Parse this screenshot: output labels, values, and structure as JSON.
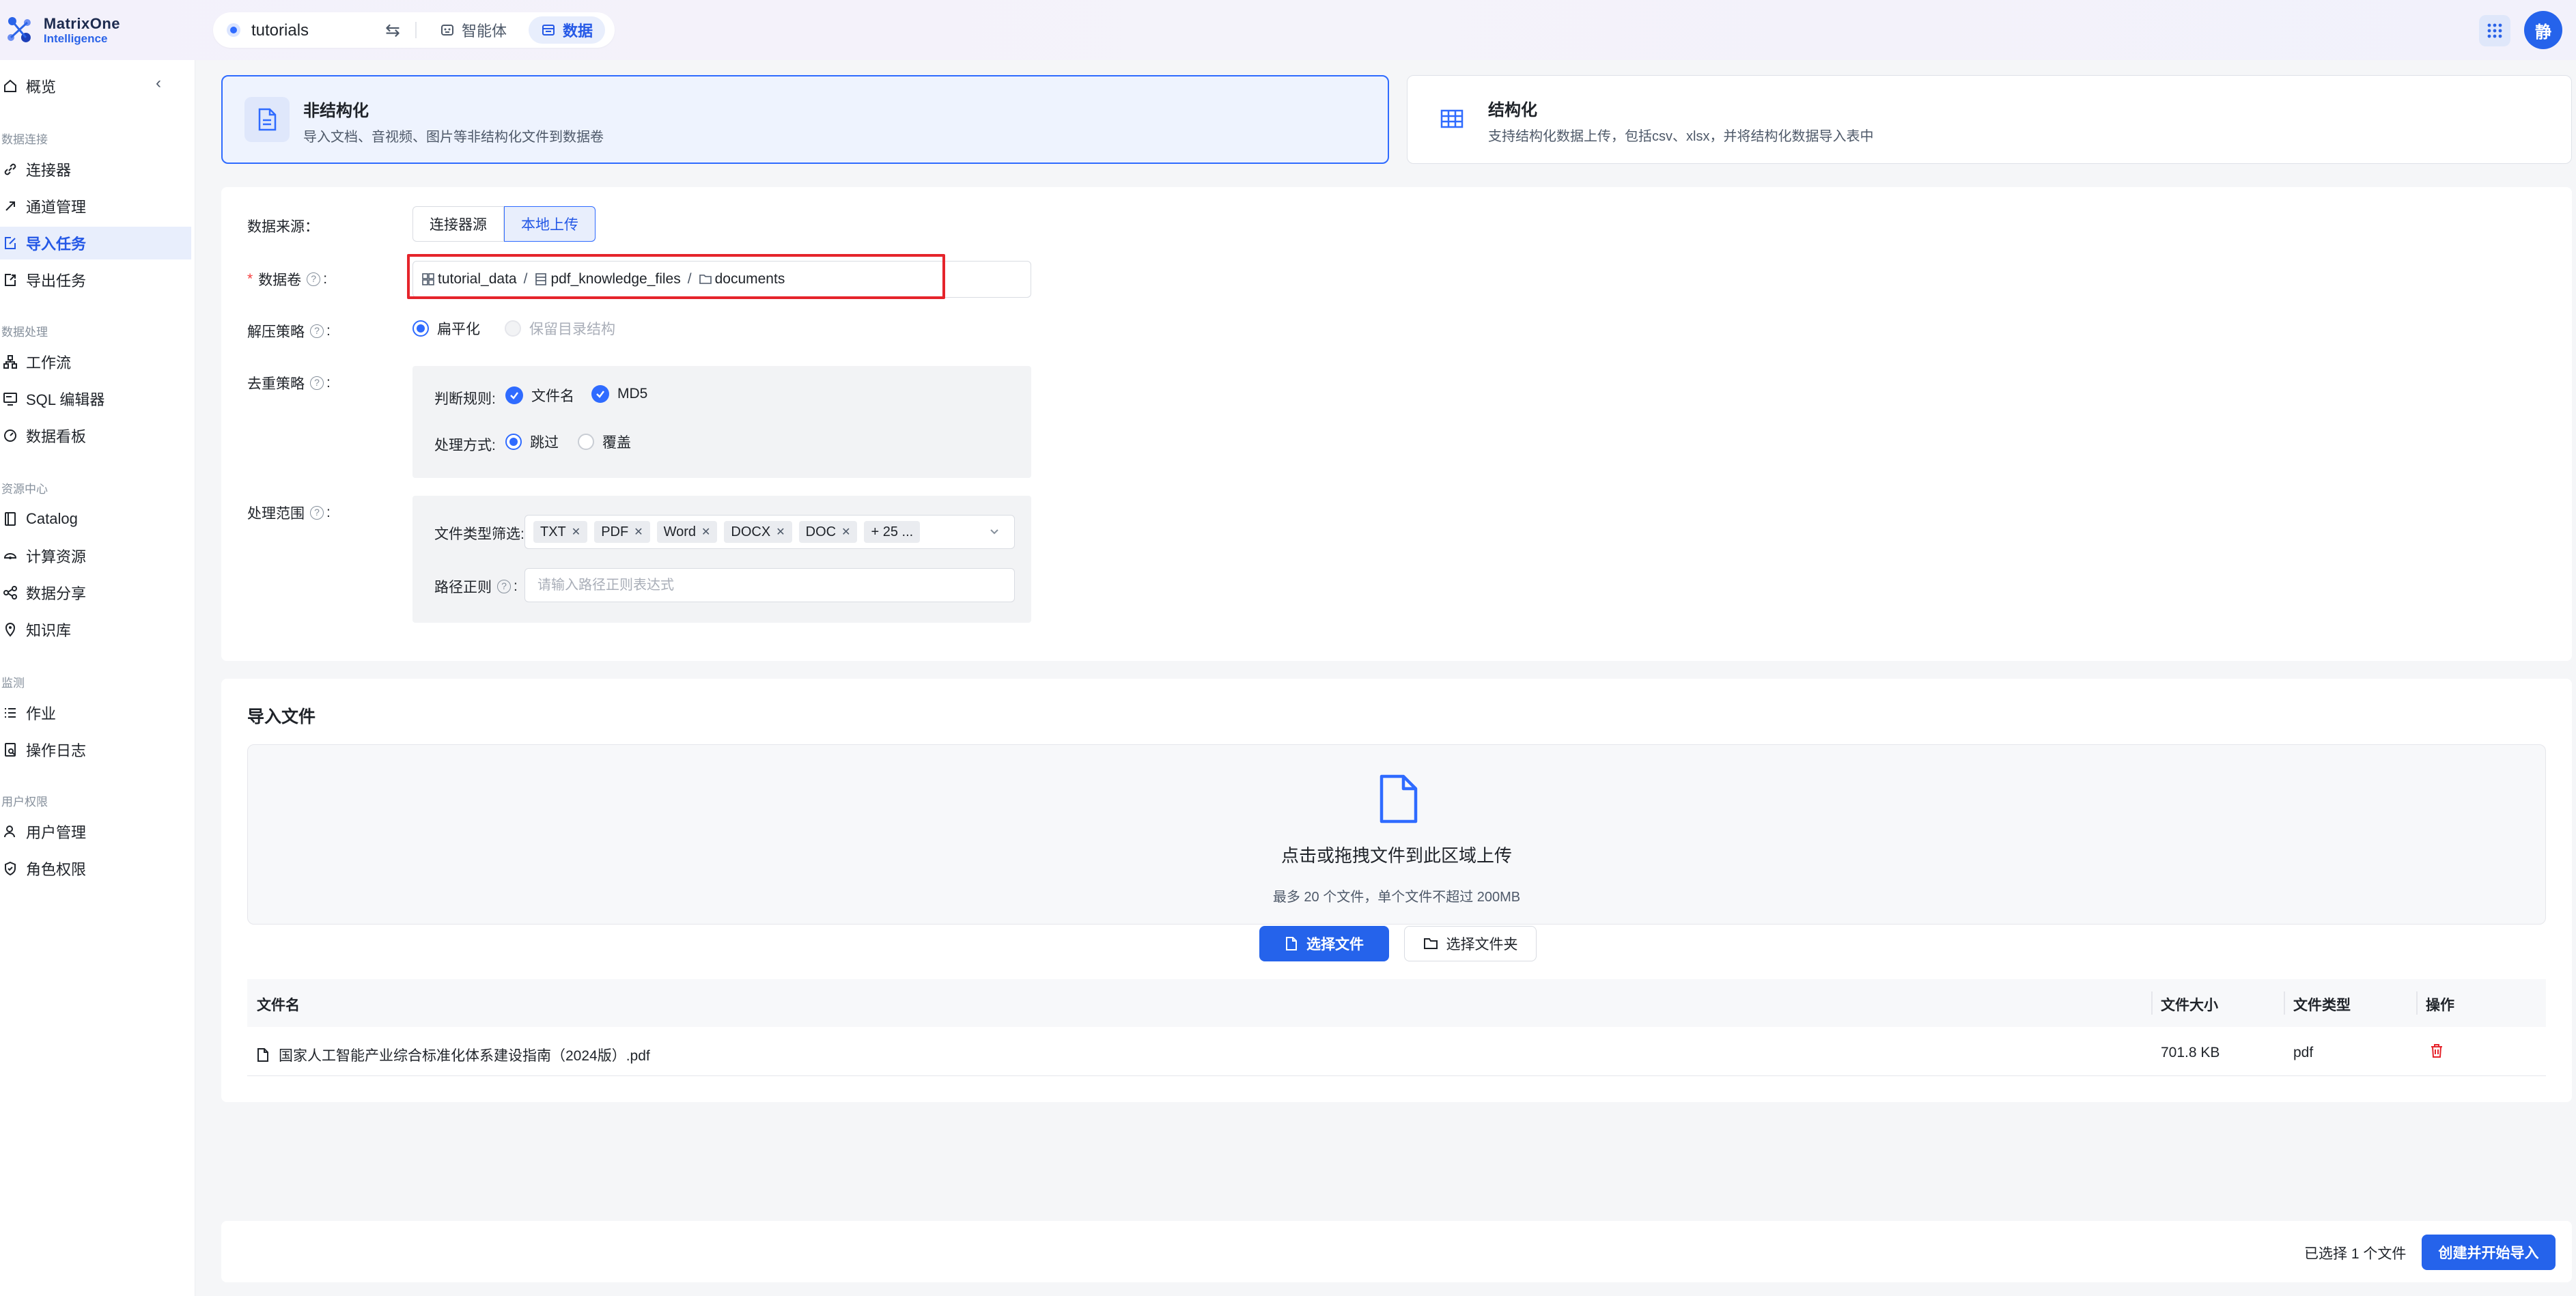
{
  "brand": {
    "line1": "MatrixOne",
    "line2": "Intelligence"
  },
  "topbar": {
    "workspace": "tutorials",
    "tabs": [
      {
        "label": "智能体",
        "icon": "robot-icon",
        "active": false
      },
      {
        "label": "数据",
        "icon": "data-icon",
        "active": true
      }
    ],
    "avatar": "静"
  },
  "sidebar": {
    "overview": "概览",
    "groups": [
      {
        "title": "数据连接",
        "items": [
          {
            "label": "连接器",
            "icon": "link-icon"
          },
          {
            "label": "通道管理",
            "icon": "channel-icon"
          },
          {
            "label": "导入任务",
            "icon": "import-icon",
            "active": true
          },
          {
            "label": "导出任务",
            "icon": "export-icon"
          }
        ]
      },
      {
        "title": "数据处理",
        "items": [
          {
            "label": "工作流",
            "icon": "workflow-icon"
          },
          {
            "label": "SQL 编辑器",
            "icon": "sql-icon"
          },
          {
            "label": "数据看板",
            "icon": "dashboard-icon"
          }
        ]
      },
      {
        "title": "资源中心",
        "items": [
          {
            "label": "Catalog",
            "icon": "catalog-icon"
          },
          {
            "label": "计算资源",
            "icon": "compute-icon"
          },
          {
            "label": "数据分享",
            "icon": "share-icon"
          },
          {
            "label": "知识库",
            "icon": "knowledge-icon"
          }
        ]
      },
      {
        "title": "监测",
        "items": [
          {
            "label": "作业",
            "icon": "list-icon"
          },
          {
            "label": "操作日志",
            "icon": "log-icon"
          }
        ]
      },
      {
        "title": "用户权限",
        "items": [
          {
            "label": "用户管理",
            "icon": "user-icon"
          },
          {
            "label": "角色权限",
            "icon": "shield-icon"
          }
        ]
      }
    ]
  },
  "type_cards": {
    "unstructured": {
      "title": "非结构化",
      "desc": "导入文档、音视频、图片等非结构化文件到数据卷",
      "selected": true
    },
    "structured": {
      "title": "结构化",
      "desc": "支持结构化数据上传，包括csv、xlsx，并将结构化数据导入表中",
      "selected": false
    }
  },
  "form": {
    "source_label": "数据来源：",
    "source_options": [
      "连接器源",
      "本地上传"
    ],
    "source_selected": "本地上传",
    "volume_label": "数据卷",
    "volume_path": [
      "tutorial_data",
      "pdf_knowledge_files",
      "documents"
    ],
    "unzip_label": "解压策略",
    "unzip_options": [
      "扁平化",
      "保留目录结构"
    ],
    "dedup_label": "去重策略",
    "rule_label": "判断规则:",
    "rule_options": [
      "文件名",
      "MD5"
    ],
    "method_label": "处理方式:",
    "method_options": [
      "跳过",
      "覆盖"
    ],
    "scope_label": "处理范围",
    "filetype_label": "文件类型筛选:",
    "filetype_tags": [
      "TXT",
      "PDF",
      "Word",
      "DOCX",
      "DOC"
    ],
    "filetype_more": "+ 25 ...",
    "regex_label": "路径正则",
    "regex_placeholder": "请输入路径正则表达式",
    "colon": ":"
  },
  "import": {
    "title": "导入文件",
    "drop_main": "点击或拖拽文件到此区域上传",
    "drop_sub": "最多 20 个文件，单个文件不超过 200MB",
    "btn_file": "选择文件",
    "btn_folder": "选择文件夹",
    "columns": [
      "文件名",
      "文件大小",
      "文件类型",
      "操作"
    ],
    "rows": [
      {
        "name": "国家人工智能产业综合标准化体系建设指南（2024版）.pdf",
        "size": "701.8 KB",
        "type": "pdf"
      }
    ]
  },
  "footer": {
    "selected_count": "已选择 1 个文件",
    "submit": "创建并开始导入"
  },
  "colors": {
    "accent": "#2563eb",
    "danger": "#e5242b",
    "active_bg": "#e8eefc"
  }
}
